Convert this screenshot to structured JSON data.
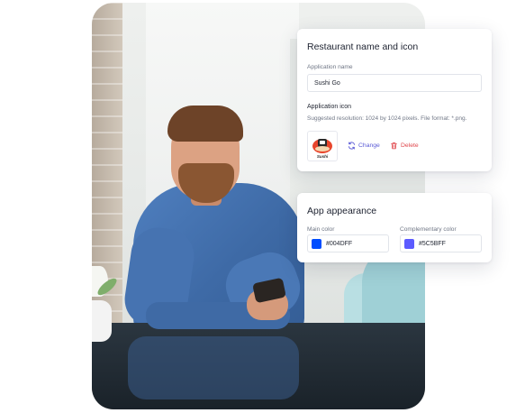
{
  "restaurant_card": {
    "title": "Restaurant name and icon",
    "app_name_label": "Application name",
    "app_name_value": "Sushi Go",
    "app_icon_label": "Application icon",
    "app_icon_hint": "Suggested resolution: 1024 by 1024 pixels. File format: *.png.",
    "logo_text": "Sushi",
    "change_label": "Change",
    "delete_label": "Delete"
  },
  "appearance_card": {
    "title": "App appearance",
    "main_color_label": "Main color",
    "main_color_value": "#004DFF",
    "complementary_color_label": "Complementary color",
    "complementary_color_value": "#5C5BFF"
  },
  "colors": {
    "main": "#004DFF",
    "complementary": "#5C5BFF",
    "change_accent": "#5B5BD6",
    "delete_accent": "#E0474C"
  },
  "icons": [
    "refresh-icon",
    "trash-icon",
    "sushi-logo"
  ]
}
